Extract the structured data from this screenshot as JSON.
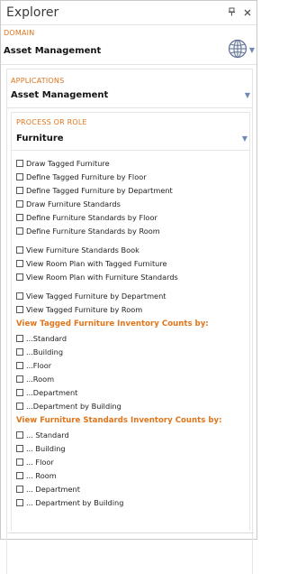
{
  "window": {
    "title": "Explorer",
    "pin_icon": "pin-icon",
    "close_icon": "close-icon",
    "pin_glyph": "Ը",
    "close_glyph": "✕"
  },
  "domain": {
    "label": "DOMAIN",
    "value": "Asset Management",
    "icon": "globe-icon"
  },
  "applications": {
    "label": "APPLICATIONS",
    "value": "Asset Management"
  },
  "process": {
    "label": "PROCESS OR ROLE",
    "value": "Furniture"
  },
  "tasks_group1": [
    "Draw Tagged Furniture",
    "Define Tagged Furniture by Floor",
    "Define Tagged Furniture by Department",
    "Draw Furniture Standards",
    "Define Furniture Standards by Floor",
    "Define Furniture Standards by Room"
  ],
  "tasks_group2": [
    "View Furniture Standards Book",
    "View Room Plan with Tagged Furniture",
    "View Room Plan with Furniture Standards"
  ],
  "tasks_group3": [
    "View Tagged Furniture by Department",
    "View Tagged Furniture by Room"
  ],
  "tagged_counts": {
    "heading": "View Tagged Furniture Inventory Counts by:",
    "items": [
      "...Standard",
      "...Building",
      "...Floor",
      "...Room",
      "...Department",
      "...Department by Building"
    ]
  },
  "standards_counts": {
    "heading": "View Furniture Standards Inventory Counts by:",
    "items": [
      "... Standard",
      "... Building",
      "... Floor",
      "... Room",
      "... Department",
      "... Department by Building"
    ]
  },
  "colors": {
    "accent": "#e0751c",
    "dropdown_arrow": "#6f88b8",
    "border": "#c9c9c9"
  }
}
